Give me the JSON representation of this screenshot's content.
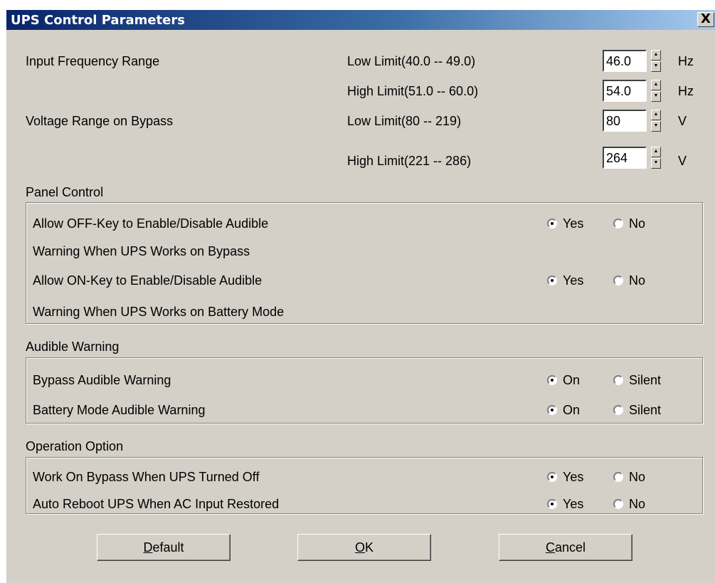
{
  "window": {
    "title": "UPS Control Parameters",
    "close_glyph": "X"
  },
  "frequency": {
    "label": "Input Frequency Range",
    "low": {
      "label": "Low Limit(40.0 -- 49.0)",
      "value": "46.0",
      "unit": "Hz"
    },
    "high": {
      "label": "High Limit(51.0 -- 60.0)",
      "value": "54.0",
      "unit": "Hz"
    }
  },
  "voltage": {
    "label": "Voltage Range on Bypass",
    "low": {
      "label": "Low Limit(80 -- 219)",
      "value": "80",
      "unit": "V"
    },
    "high": {
      "label": "High Limit(221 -- 286)",
      "value": "264",
      "unit": "V"
    }
  },
  "panel_control": {
    "header": "Panel Control",
    "off_key": {
      "line1": "Allow OFF-Key to Enable/Disable Audible",
      "line2": "Warning When UPS Works on Bypass",
      "opt1": "Yes",
      "opt2": "No",
      "selected": "Yes"
    },
    "on_key": {
      "line1": "Allow ON-Key to Enable/Disable Audible",
      "line2": "Warning When UPS Works on Battery Mode",
      "opt1": "Yes",
      "opt2": "No",
      "selected": "Yes"
    }
  },
  "audible_warning": {
    "header": "Audible Warning",
    "bypass": {
      "label": "Bypass Audible Warning",
      "opt1": "On",
      "opt2": "Silent",
      "selected": "On"
    },
    "battery": {
      "label": "Battery Mode Audible Warning",
      "opt1": "On",
      "opt2": "Silent",
      "selected": "On"
    }
  },
  "operation_option": {
    "header": "Operation Option",
    "bypass_off": {
      "label": "Work On Bypass When UPS Turned Off",
      "opt1": "Yes",
      "opt2": "No",
      "selected": "Yes"
    },
    "auto_reboot": {
      "label": "Auto Reboot UPS When AC Input Restored",
      "opt1": "Yes",
      "opt2": "No",
      "selected": "Yes"
    }
  },
  "buttons": {
    "default": {
      "key": "D",
      "rest": "efault"
    },
    "ok": {
      "key": "O",
      "rest": "K"
    },
    "cancel": {
      "key": "C",
      "rest": "ancel"
    }
  }
}
